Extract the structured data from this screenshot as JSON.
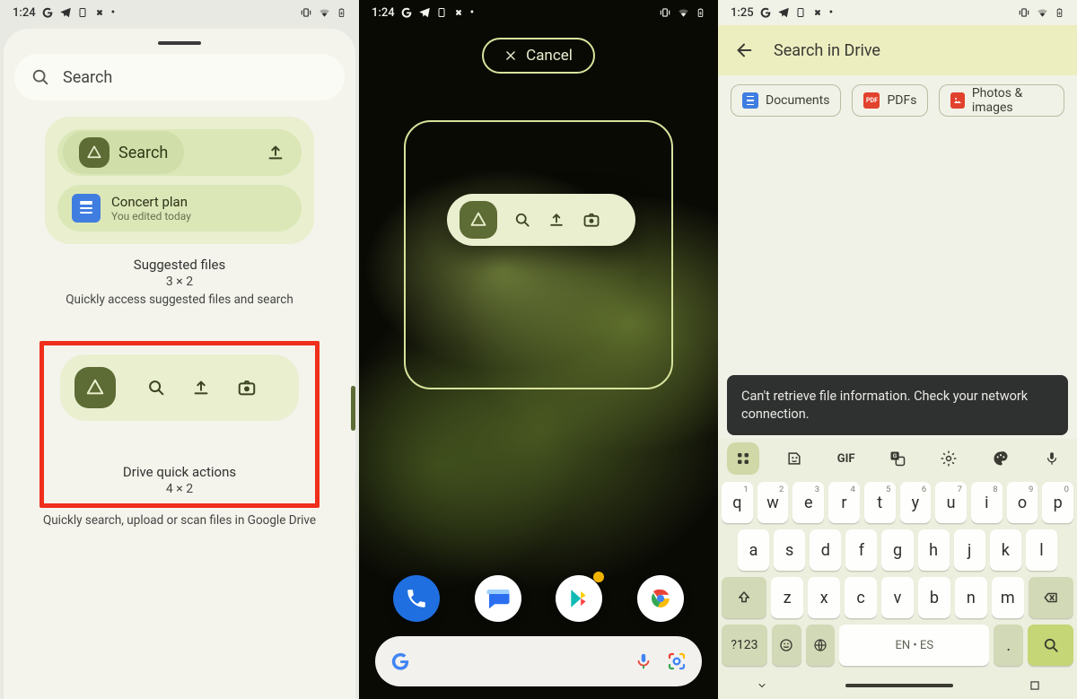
{
  "status": {
    "time1": "1:24",
    "time2": "1:24",
    "time3": "1:25"
  },
  "screen1": {
    "search_placeholder": "Search",
    "widget1": {
      "search_label": "Search",
      "doc_title": "Concert plan",
      "doc_sub": "You edited today",
      "name": "Suggested files",
      "size": "3 × 2",
      "desc": "Quickly access suggested files and search"
    },
    "widget2": {
      "name": "Drive quick actions",
      "size": "4 × 2",
      "desc": "Quickly search, upload or scan files in Google Drive"
    }
  },
  "screen2": {
    "cancel_label": "Cancel"
  },
  "screen3": {
    "title": "Search in Drive",
    "chips": {
      "docs": "Documents",
      "pdfs": "PDFs",
      "photos": "Photos & images"
    },
    "toast": "Can't retrieve file information. Check your network connection.",
    "keyboard": {
      "row1": [
        "q",
        "w",
        "e",
        "r",
        "t",
        "y",
        "u",
        "i",
        "o",
        "p"
      ],
      "row1_sup": [
        "1",
        "2",
        "3",
        "4",
        "5",
        "6",
        "7",
        "8",
        "9",
        "0"
      ],
      "row2": [
        "a",
        "s",
        "d",
        "f",
        "g",
        "h",
        "j",
        "k",
        "l"
      ],
      "row3": [
        "z",
        "x",
        "c",
        "v",
        "b",
        "n",
        "m"
      ],
      "num_label": "?123",
      "space_label": "EN • ES",
      "gif_label": "GIF"
    }
  }
}
